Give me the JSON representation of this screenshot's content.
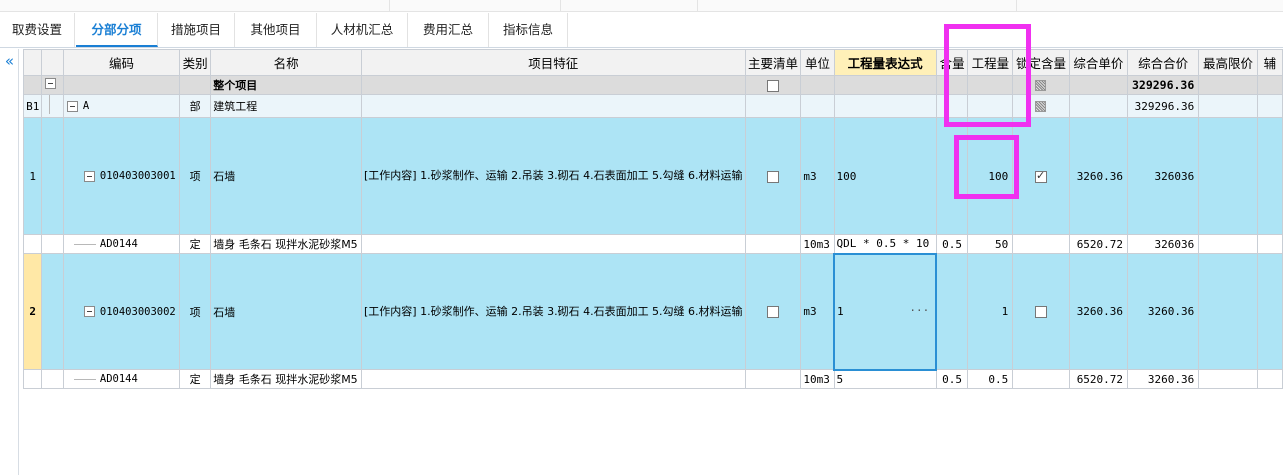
{
  "tabs": [
    "取费设置",
    "分部分项",
    "措施项目",
    "其他项目",
    "人材机汇总",
    "费用汇总",
    "指标信息"
  ],
  "active_tab": "分部分项",
  "columns": [
    "编码",
    "类别",
    "名称",
    "项目特征",
    "主要清单",
    "单位",
    "工程量表达式",
    "含量",
    "工程量",
    "锁定含量",
    "综合单价",
    "综合合价",
    "最高限价",
    "辅"
  ],
  "rows": {
    "total": {
      "name": "整个项目",
      "total": "329296.36"
    },
    "b1": {
      "idx": "B1",
      "code": "A",
      "type": "部",
      "name": "建筑工程",
      "total": "329296.36"
    },
    "item1": {
      "idx": "1",
      "code": "010403003001",
      "type": "项",
      "name": "石墙",
      "features": "[工作内容]\n1.砂浆制作、运输\n2.吊装\n3.砌石\n4.石表面加工\n5.勾缝\n6.材料运输",
      "unit": "m3",
      "expr": "100",
      "qty": "100",
      "lock": true,
      "price": "3260.36",
      "total": "326036"
    },
    "sub1": {
      "code": "AD0144",
      "type": "定",
      "name": "墙身 毛条石 现拌水泥砂浆M5",
      "unit": "10m3",
      "expr": "QDL * 0.5 * 10",
      "content": "0.5",
      "qty": "50",
      "price": "6520.72",
      "total": "326036"
    },
    "item2": {
      "idx": "2",
      "code": "010403003002",
      "type": "项",
      "name": "石墙",
      "features": "[工作内容]\n1.砂浆制作、运输\n2.吊装\n3.砌石\n4.石表面加工\n5.勾缝\n6.材料运输",
      "unit": "m3",
      "expr": "1",
      "expr_more": "···",
      "qty": "1",
      "lock": false,
      "price": "3260.36",
      "total": "3260.36"
    },
    "sub2": {
      "code": "AD0144",
      "type": "定",
      "name": "墙身 毛条石 现拌水泥砂浆M5",
      "unit": "10m3",
      "expr": "5",
      "content": "0.5",
      "qty": "0.5",
      "price": "6520.72",
      "total": "3260.36"
    }
  },
  "colors": {
    "accent": "#1a7fd4",
    "row_highlight": "#ade4f5",
    "annotation": "#f030f0",
    "header_highlight": "#fff0b8"
  }
}
